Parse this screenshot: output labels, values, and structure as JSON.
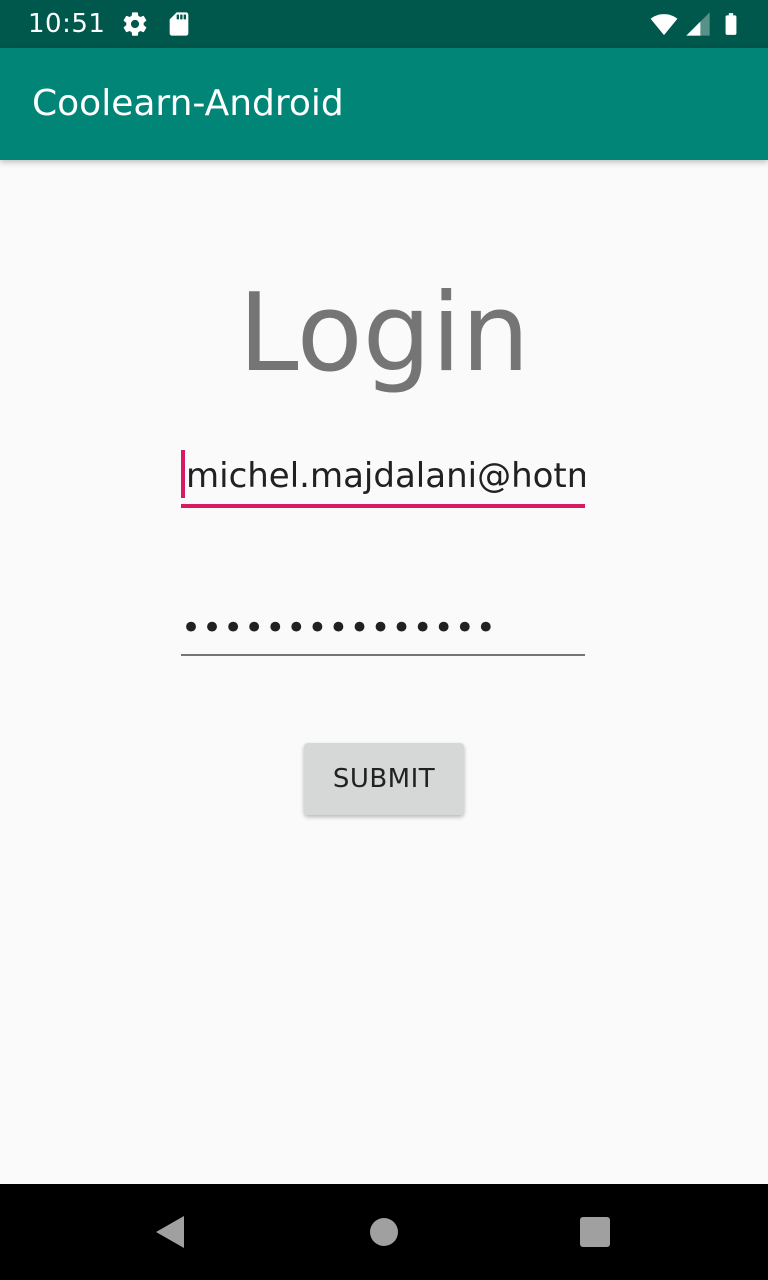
{
  "status_bar": {
    "time": "10:51",
    "icons": [
      "settings-icon",
      "sd-card-icon",
      "wifi-icon",
      "cell-signal-icon",
      "battery-icon"
    ]
  },
  "app_bar": {
    "title": "Coolearn-Android"
  },
  "login": {
    "heading": "Login",
    "email_value": "michel.majdalani@hotma",
    "password_masked": "•••••••••••••••",
    "submit_label": "SUBMIT"
  },
  "colors": {
    "status_bar": "#00574b",
    "app_bar": "#008577",
    "accent": "#d81b60",
    "background": "#fafafa"
  },
  "nav_bar": {
    "icons": [
      "back-icon",
      "home-icon",
      "recents-icon"
    ]
  }
}
